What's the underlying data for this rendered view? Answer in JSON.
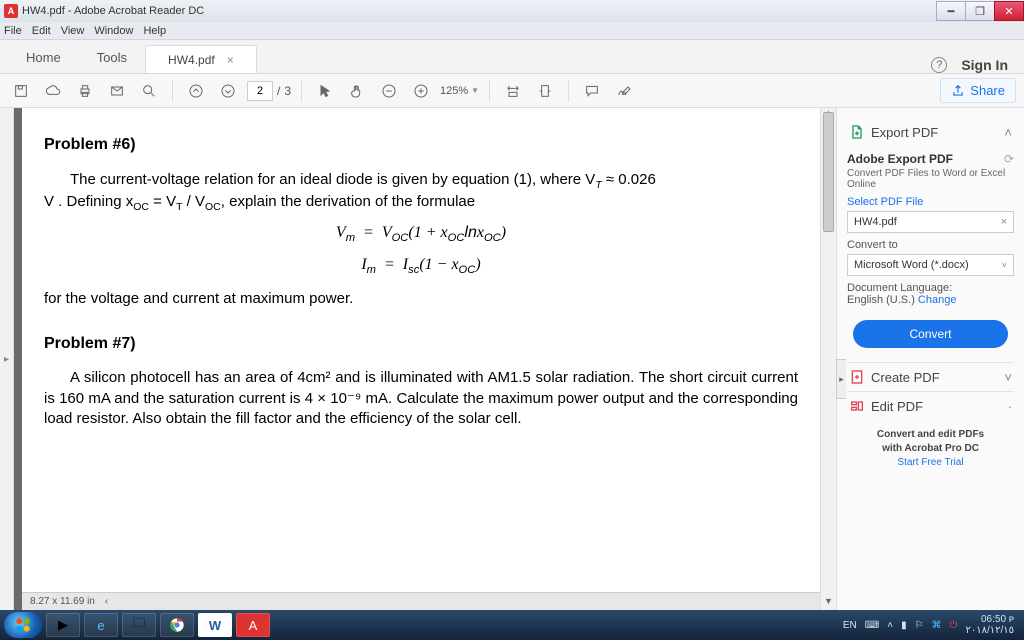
{
  "title": "HW4.pdf - Adobe Acrobat Reader DC",
  "menu": {
    "file": "File",
    "edit": "Edit",
    "view": "View",
    "window": "Window",
    "help": "Help"
  },
  "tabs": {
    "home": "Home",
    "tools": "Tools",
    "doc": "HW4.pdf",
    "signin": "Sign In"
  },
  "toolbar": {
    "page_current": "2",
    "page_sep": "/",
    "page_total": "3",
    "zoom": "125%",
    "share": "Share"
  },
  "document": {
    "p6_title": "Problem #6)",
    "p6_line1": "The current-voltage relation for an ideal diode is given by equation (1), where V",
    "p6_vt": "T",
    "p6_approx": " ≈ 0.026",
    "p6_line2a": "V . Defining x",
    "p6_oc": "OC",
    "p6_eq_frac": " = V",
    "p6_t": "T",
    "p6_over": " / V",
    "p6_oc2": "OC",
    "p6_line2b": ", explain the derivation of the formulae",
    "formula1": "Vₘ  =  V_{OC}(1 + x_{OC} ln x_{OC})",
    "formula2": "Iₘ  =  I_{sc}(1 − x_{OC})",
    "p6_line3": "for the voltage and current at maximum power.",
    "p7_title": "Problem #7)",
    "p7_body": "A silicon photocell has an area of 4cm² and is illuminated with AM1.5 solar radiation. The short circuit current is 160 mA and the saturation current is 4 × 10⁻⁹ mA. Calculate the maximum power output and the corresponding load resistor. Also obtain the fill factor and the efficiency of the solar cell.",
    "pagesize": "8.27 x 11.69 in"
  },
  "side": {
    "export": "Export PDF",
    "exp_head": "Adobe Export PDF",
    "exp_sub": "Convert PDF Files to Word or Excel Online",
    "selectfile": "Select PDF File",
    "filename": "HW4.pdf",
    "convertto": "Convert to",
    "target": "Microsoft Word (*.docx)",
    "lang_label": "Document Language:",
    "lang": "English (U.S.)",
    "change": "Change",
    "convert": "Convert",
    "create": "Create PDF",
    "edit": "Edit PDF",
    "promo1": "Convert and edit PDFs",
    "promo2": "with Acrobat Pro DC",
    "trial": "Start Free Trial"
  },
  "tray": {
    "lang": "EN",
    "time": "06:50 ᴘ",
    "date": "٢٠١٨/١٢/١٥"
  }
}
